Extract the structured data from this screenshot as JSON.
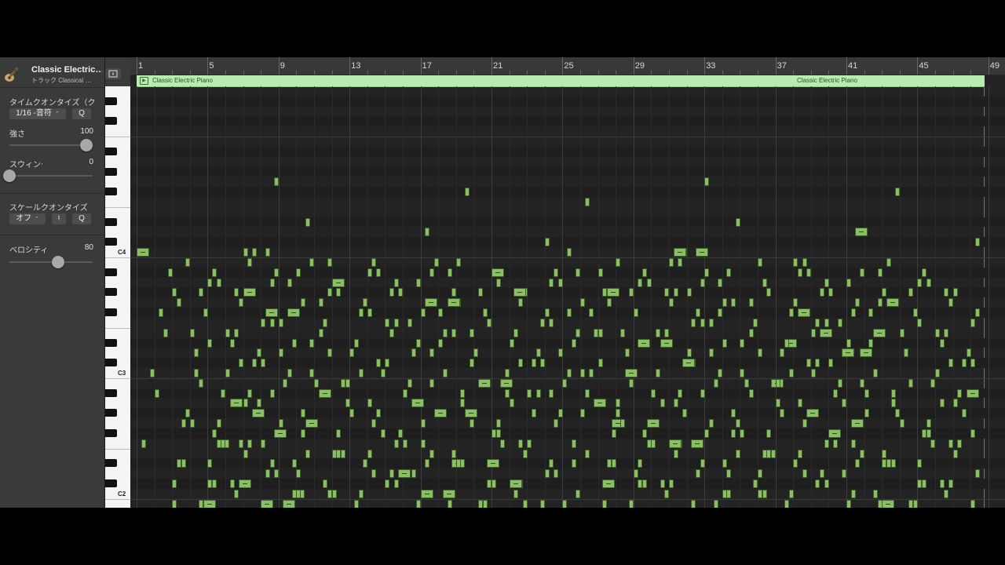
{
  "track": {
    "name": "Classic Electric…",
    "subtitle": "トラック Classical …",
    "icon": "guitar-icon"
  },
  "time_quantize": {
    "label": "タイムクオンタイズ（ク",
    "value": "1/16 -音符",
    "q_button": "Q",
    "strength_label": "強さ",
    "strength_value": "100",
    "strength_level": 1.0,
    "swing_label": "スウィング",
    "swing_value": "0",
    "swing_level": 0.0
  },
  "scale_quantize": {
    "label": "スケールクオンタイズ",
    "mode": "オフ",
    "scale": "♮",
    "q_button": "Q"
  },
  "velocity": {
    "label": "ベロシティ",
    "value": "80",
    "level": 0.63
  },
  "ruler": {
    "bars": [
      "1",
      "5",
      "9",
      "13",
      "17",
      "21",
      "25",
      "29",
      "33",
      "37",
      "41",
      "45",
      "49"
    ]
  },
  "region": {
    "name_1": "Classic Electric Piano",
    "name_2": "Classic Electric Piano",
    "color": "#b9ecb1"
  },
  "keyboard": {
    "labels": [
      "C4",
      "C3",
      "C2"
    ]
  },
  "colors": {
    "note": "#8bbf63",
    "background": "#232323"
  }
}
